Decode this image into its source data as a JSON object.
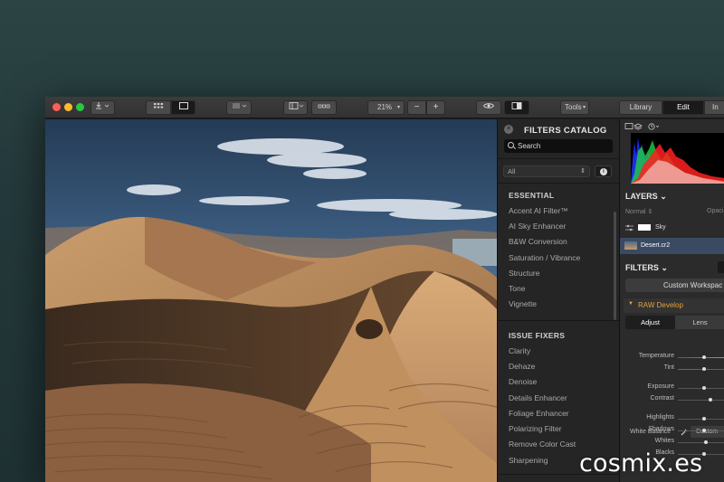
{
  "toolbar": {
    "zoom": "21%",
    "minus": "−",
    "plus": "+",
    "tools_label": "Tools",
    "tabs": [
      "Library",
      "Edit",
      "In"
    ]
  },
  "catalog": {
    "title": "FILTERS CATALOG",
    "search_placeholder": "Search",
    "dropdown_value": "All",
    "sections": [
      {
        "title": "ESSENTIAL",
        "items": [
          "Accent AI Filter™",
          "AI Sky Enhancer",
          "B&W Conversion",
          "Saturation / Vibrance",
          "Structure",
          "Tone",
          "Vignette"
        ]
      },
      {
        "title": "ISSUE FIXERS",
        "items": [
          "Clarity",
          "Dehaze",
          "Denoise",
          "Details Enhancer",
          "Foliage Enhancer",
          "Polarizing Filter",
          "Remove Color Cast",
          "Sharpening"
        ]
      }
    ]
  },
  "layers": {
    "title": "LAYERS",
    "blend_mode": "Normal",
    "opacity_label": "Opaci",
    "items": [
      {
        "name": "Sky"
      },
      {
        "name": "Desert.cr2"
      }
    ]
  },
  "filters": {
    "title": "FILTERS",
    "workspace": "Custom Workspac",
    "raw_develop": "RAW Develop",
    "tabs": [
      "Adjust",
      "Lens"
    ],
    "white_balance_label": "White Balance",
    "white_balance_value": "Custom",
    "sliders": [
      {
        "label": "Temperature",
        "level": 0.55
      },
      {
        "label": "Tint",
        "level": 0.55
      },
      {
        "label": "Exposure",
        "level": 0.55
      },
      {
        "label": "Contrast",
        "level": 0.7
      },
      {
        "label": "Highlights",
        "level": 0.55
      },
      {
        "label": "Shadows",
        "level": 0.55
      },
      {
        "label": "Whites",
        "level": 0.6
      },
      {
        "label": "Blacks",
        "level": 0.55
      }
    ]
  },
  "watermark": "cosmix.es",
  "colors": {
    "accent_orange": "#e8a23c",
    "selected_row": "#3a4a63"
  }
}
